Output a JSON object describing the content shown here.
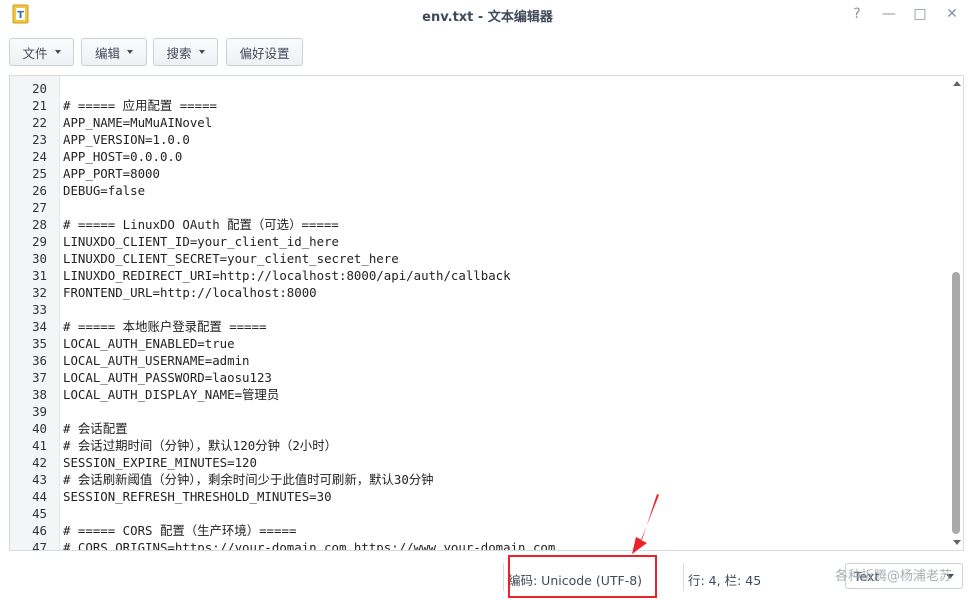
{
  "window": {
    "title": "env.txt - 文本编辑器",
    "buttons": [
      "?",
      "—",
      "□",
      "✕"
    ]
  },
  "toolbar": {
    "file_label": "文件",
    "edit_label": "编辑",
    "search_label": "搜索",
    "prefs_label": "偏好设置"
  },
  "editor": {
    "lines": [
      {
        "n": "20",
        "text": ""
      },
      {
        "n": "21",
        "text": "# ===== 应用配置 ====="
      },
      {
        "n": "22",
        "text": "APP_NAME=MuMuAINovel"
      },
      {
        "n": "23",
        "text": "APP_VERSION=1.0.0"
      },
      {
        "n": "24",
        "text": "APP_HOST=0.0.0.0"
      },
      {
        "n": "25",
        "text": "APP_PORT=8000"
      },
      {
        "n": "26",
        "text": "DEBUG=false"
      },
      {
        "n": "27",
        "text": ""
      },
      {
        "n": "28",
        "text": "# ===== LinuxDO OAuth 配置（可选）====="
      },
      {
        "n": "29",
        "text": "LINUXDO_CLIENT_ID=your_client_id_here"
      },
      {
        "n": "30",
        "text": "LINUXDO_CLIENT_SECRET=your_client_secret_here"
      },
      {
        "n": "31",
        "text": "LINUXDO_REDIRECT_URI=http://localhost:8000/api/auth/callback"
      },
      {
        "n": "32",
        "text": "FRONTEND_URL=http://localhost:8000"
      },
      {
        "n": "33",
        "text": ""
      },
      {
        "n": "34",
        "text": "# ===== 本地账户登录配置 ====="
      },
      {
        "n": "35",
        "text": "LOCAL_AUTH_ENABLED=true"
      },
      {
        "n": "36",
        "text": "LOCAL_AUTH_USERNAME=admin"
      },
      {
        "n": "37",
        "text": "LOCAL_AUTH_PASSWORD=laosu123"
      },
      {
        "n": "38",
        "text": "LOCAL_AUTH_DISPLAY_NAME=管理员"
      },
      {
        "n": "39",
        "text": ""
      },
      {
        "n": "40",
        "text": "# 会话配置"
      },
      {
        "n": "41",
        "text": "# 会话过期时间（分钟），默认120分钟（2小时）"
      },
      {
        "n": "42",
        "text": "SESSION_EXPIRE_MINUTES=120"
      },
      {
        "n": "43",
        "text": "# 会话刷新阈值（分钟），剩余时间少于此值时可刷新，默认30分钟"
      },
      {
        "n": "44",
        "text": "SESSION_REFRESH_THRESHOLD_MINUTES=30"
      },
      {
        "n": "45",
        "text": ""
      },
      {
        "n": "46",
        "text": "# ===== CORS 配置（生产环境）====="
      },
      {
        "n": "47",
        "text": "# CORS_ORIGINS=https://your-domain.com,https://www.your-domain.com"
      }
    ]
  },
  "status": {
    "encoding": "编码: Unicode (UTF-8)",
    "position": "行: 4, 栏: 45",
    "language": "Text",
    "watermark": "各种折腾@杨浦老苏"
  },
  "colors": {
    "highlight": "#e8232a",
    "title": "#3f4a59"
  }
}
